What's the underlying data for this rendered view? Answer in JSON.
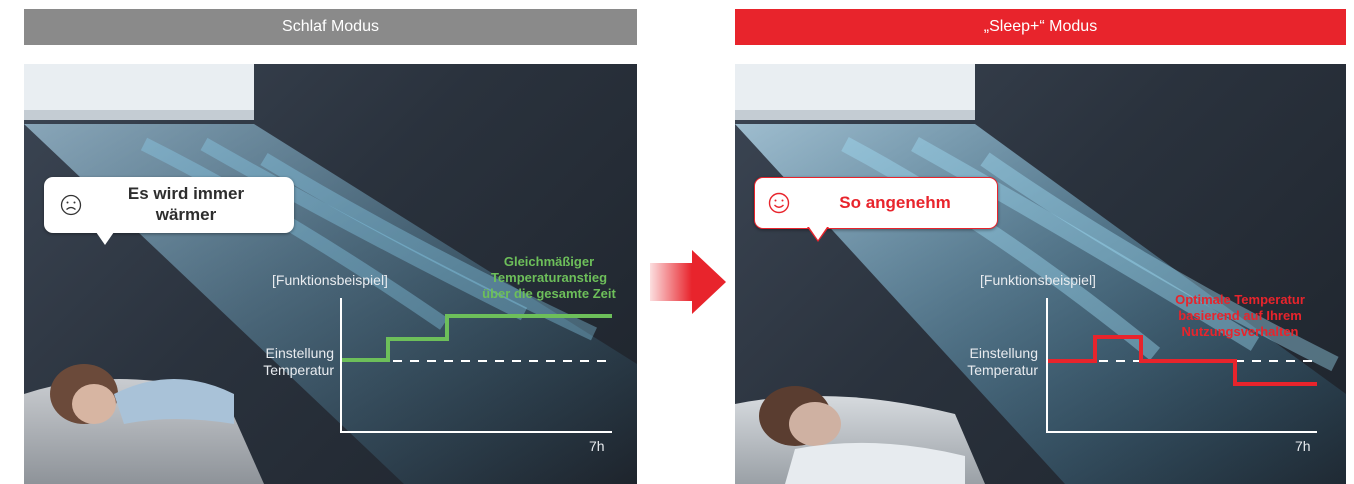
{
  "left": {
    "header": "Schlaf Modus",
    "header_color": "#8a8a8a",
    "bubble": {
      "line1": "Es wird immer",
      "line2": "wärmer",
      "face": "sad-face-icon"
    },
    "chart_caption": "[Funktionsbeispiel]",
    "y_label_line1": "Einstellung",
    "y_label_line2": "Temperatur",
    "x_end_label": "7h",
    "annotation": [
      "Gleichmäßiger",
      "Temperaturanstieg",
      "über die gesamte Zeit"
    ],
    "annotation_color": "#6dbf5a"
  },
  "right": {
    "header": "„Sleep+“ Modus",
    "header_color": "#e8242c",
    "bubble": {
      "text": "So angenehm",
      "face": "happy-face-icon"
    },
    "chart_caption": "[Funktionsbeispiel]",
    "y_label_line1": "Einstellung",
    "y_label_line2": "Temperatur",
    "x_end_label": "7h",
    "annotation": [
      "Optimale Temperatur",
      "basierend auf Ihrem",
      "Nutzungsverhalten"
    ],
    "annotation_color": "#e8242c"
  },
  "arrow": {
    "icon": "right-arrow-icon",
    "color": "#e8242c"
  }
}
